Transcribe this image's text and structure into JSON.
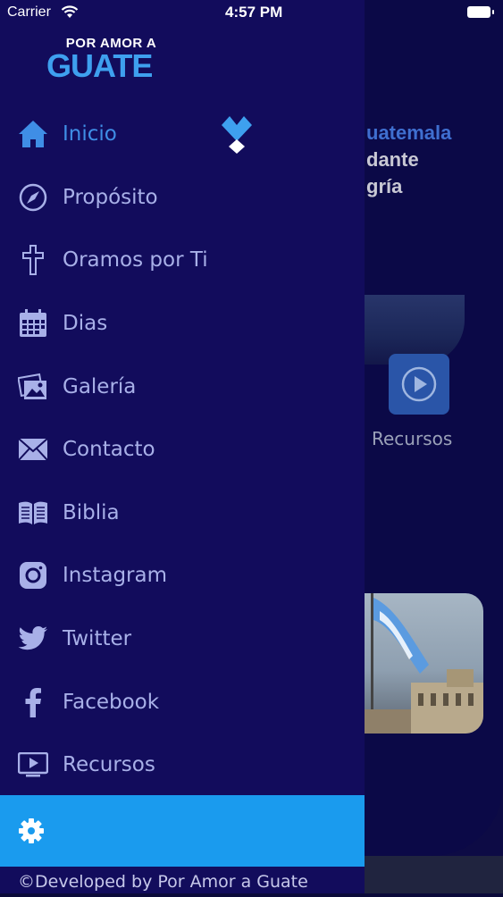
{
  "status_bar": {
    "carrier": "Carrier",
    "time": "4:57 PM"
  },
  "background": {
    "heading": "uatemala",
    "line1": "dante",
    "line2": "gría",
    "tile_label": "Recursos"
  },
  "drawer": {
    "logo_top": "POR AMOR A",
    "logo_main": "GUATE",
    "items": [
      {
        "label": "Inicio",
        "icon": "home-icon"
      },
      {
        "label": "Propósito",
        "icon": "compass-icon"
      },
      {
        "label": "Oramos por Ti",
        "icon": "cross-icon"
      },
      {
        "label": "Dias",
        "icon": "calendar-icon"
      },
      {
        "label": "Galería",
        "icon": "gallery-icon"
      },
      {
        "label": "Contacto",
        "icon": "envelope-icon"
      },
      {
        "label": "Biblia",
        "icon": "book-icon"
      },
      {
        "label": "Instagram",
        "icon": "instagram-icon"
      },
      {
        "label": "Twitter",
        "icon": "twitter-icon"
      },
      {
        "label": "Facebook",
        "icon": "facebook-icon"
      },
      {
        "label": "Recursos",
        "icon": "video-icon"
      }
    ],
    "footer": "©Developed by Por Amor a Guate"
  },
  "colors": {
    "drawer_bg": "#120c5c",
    "active": "#3f8ee6",
    "inactive": "#a8b0e8",
    "settings_bar": "#1a9bee"
  }
}
